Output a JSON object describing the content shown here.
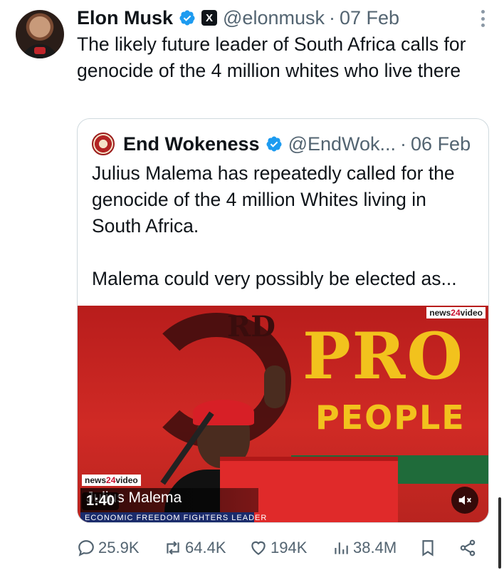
{
  "tweet": {
    "author_name": "Elon Musk",
    "handle": "@elonmusk",
    "separator": "·",
    "date": "07 Feb",
    "x_badge": "X",
    "text": "The likely future leader of South Africa calls for genocide of the 4 million whites who live there",
    "avatar_icon": "avatar-photo"
  },
  "quote": {
    "author_name": "End Wokeness",
    "handle": "@EndWok...",
    "separator": "·",
    "date": "06 Feb",
    "paragraph1": "Julius Malema has repeatedly called for the genocide of the 4 million Whites living in South Africa.",
    "paragraph2": "Malema could very possibly be elected as..."
  },
  "video": {
    "brand_prefix": "news",
    "brand_num": "24",
    "brand_suffix": "video",
    "banner_rd": "RD",
    "banner_pro": "PRO",
    "banner_people": "PEOPLE",
    "duration": "1:40",
    "caption_name": "Julius Malema",
    "caption_title": "ECONOMIC FREEDOM FIGHTERS LEADER",
    "muted": true
  },
  "actions": {
    "replies": "25.9K",
    "reposts": "64.4K",
    "likes": "194K",
    "views": "38.4M"
  },
  "colors": {
    "text": "#0f1419",
    "secondary": "#536471",
    "verified": "#1d9bf0",
    "border": "#cfd9de"
  }
}
